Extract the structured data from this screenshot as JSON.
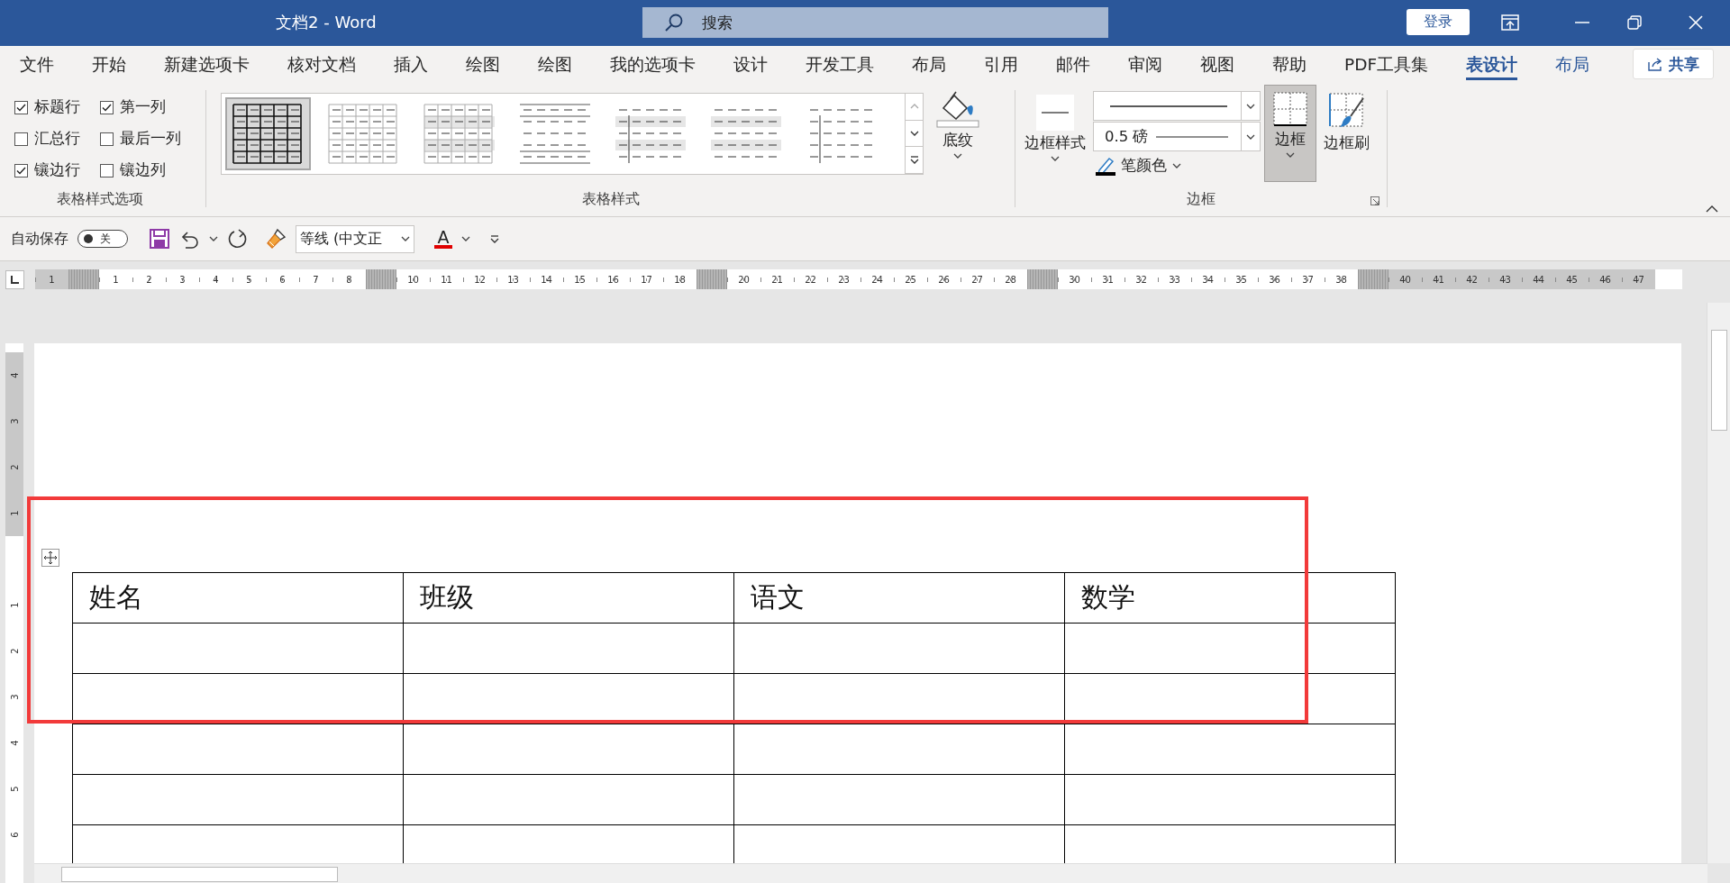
{
  "window": {
    "title": "文档2  -  Word",
    "search": {
      "placeholder": "搜索"
    },
    "sign_in": "登录"
  },
  "tabs": [
    {
      "label": "文件",
      "selected": false,
      "contextual": false
    },
    {
      "label": "开始",
      "selected": false,
      "contextual": false
    },
    {
      "label": "新建选项卡",
      "selected": false,
      "contextual": false
    },
    {
      "label": "核对文档",
      "selected": false,
      "contextual": false
    },
    {
      "label": "插入",
      "selected": false,
      "contextual": false
    },
    {
      "label": "绘图",
      "selected": false,
      "contextual": false
    },
    {
      "label": "绘图",
      "selected": false,
      "contextual": false
    },
    {
      "label": "我的选项卡",
      "selected": false,
      "contextual": false
    },
    {
      "label": "设计",
      "selected": false,
      "contextual": false
    },
    {
      "label": "开发工具",
      "selected": false,
      "contextual": false
    },
    {
      "label": "布局",
      "selected": false,
      "contextual": false
    },
    {
      "label": "引用",
      "selected": false,
      "contextual": false
    },
    {
      "label": "邮件",
      "selected": false,
      "contextual": false
    },
    {
      "label": "审阅",
      "selected": false,
      "contextual": false
    },
    {
      "label": "视图",
      "selected": false,
      "contextual": false
    },
    {
      "label": "帮助",
      "selected": false,
      "contextual": false
    },
    {
      "label": "PDF工具集",
      "selected": false,
      "contextual": false
    },
    {
      "label": "表设计",
      "selected": true,
      "contextual": true
    },
    {
      "label": "布局",
      "selected": false,
      "contextual": true
    }
  ],
  "share": "共享",
  "ribbon": {
    "style_options": {
      "label": "表格样式选项",
      "items": [
        {
          "label": "标题行",
          "checked": true
        },
        {
          "label": "第一列",
          "checked": true
        },
        {
          "label": "汇总行",
          "checked": false
        },
        {
          "label": "最后一列",
          "checked": false
        },
        {
          "label": "镶边行",
          "checked": true
        },
        {
          "label": "镶边列",
          "checked": false
        }
      ]
    },
    "table_styles": {
      "label": "表格样式",
      "shading": "底纹",
      "items": [
        {
          "kind": "grid-bold",
          "selected": true
        },
        {
          "kind": "grid-light",
          "selected": false
        },
        {
          "kind": "grid-banded",
          "selected": false
        },
        {
          "kind": "lines",
          "selected": false
        },
        {
          "kind": "first-column-banded",
          "selected": false
        },
        {
          "kind": "banded",
          "selected": false
        },
        {
          "kind": "first-column",
          "selected": false
        }
      ]
    },
    "borders": {
      "label": "边框",
      "border_styles": "边框样式",
      "line_weight": "0.5 磅",
      "pen_color": "笔颜色",
      "borders_button": {
        "label": "边框",
        "pressed": true
      },
      "border_painter": "边框刷"
    }
  },
  "quick_access": {
    "autosave": {
      "label": "自动保存",
      "on": false,
      "state_text": "关"
    },
    "font": "等线 (中文正",
    "font_color_glyph": "A"
  },
  "ruler": {
    "segments": [
      {
        "kind": "margin",
        "labels": [
          "1"
        ]
      },
      {
        "kind": "column",
        "labels": [
          "1",
          "2",
          "3",
          "4",
          "5",
          "6",
          "7",
          "8"
        ]
      },
      {
        "kind": "column",
        "labels": [
          "10",
          "11",
          "12",
          "13",
          "14",
          "15",
          "16",
          "17",
          "18"
        ]
      },
      {
        "kind": "column",
        "labels": [
          "20",
          "21",
          "22",
          "23",
          "24",
          "25",
          "26",
          "27",
          "28"
        ]
      },
      {
        "kind": "column",
        "labels": [
          "30",
          "31",
          "32",
          "33",
          "34",
          "35",
          "36",
          "37",
          "38"
        ]
      },
      {
        "kind": "margin",
        "labels": [
          "40",
          "41",
          "42",
          "43",
          "44",
          "45",
          "46",
          "47"
        ]
      }
    ]
  },
  "vertical_ruler": {
    "segments": [
      {
        "kind": "margin",
        "labels": [
          "4",
          "3",
          "2",
          "1"
        ]
      },
      {
        "kind": "column",
        "labels": [
          "1",
          "2",
          "3",
          "4",
          "5",
          "6"
        ]
      }
    ]
  },
  "document": {
    "highlight": {
      "kind": "rectangle"
    },
    "table": {
      "rows": [
        {
          "kind": "text",
          "cells": [
            "姓名",
            "班级",
            "语文",
            "数学"
          ]
        },
        {
          "kind": "blank"
        },
        {
          "kind": "blank"
        },
        {
          "kind": "blank"
        },
        {
          "kind": "blank"
        },
        {
          "kind": "blank"
        }
      ]
    }
  }
}
